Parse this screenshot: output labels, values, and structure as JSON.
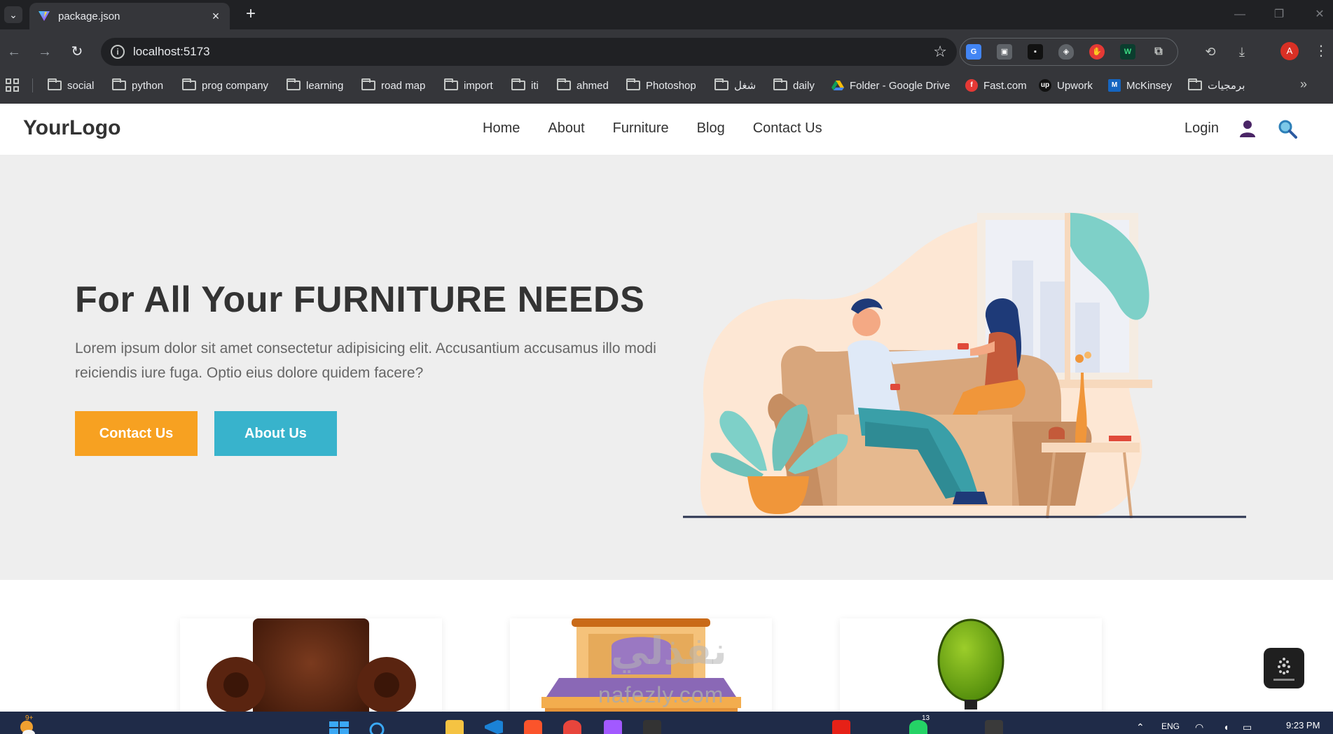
{
  "browser": {
    "tab_title": "package.json",
    "tab_close": "×",
    "new_tab": "+",
    "url": "localhost:5173",
    "profile_initial": "A",
    "window_controls": [
      "—",
      "❐",
      "✕"
    ],
    "bookmarks": [
      {
        "label": "social",
        "icon": "folder-icon"
      },
      {
        "label": "python",
        "icon": "folder-icon"
      },
      {
        "label": "prog company",
        "icon": "folder-icon"
      },
      {
        "label": "learning",
        "icon": "folder-icon"
      },
      {
        "label": "road map",
        "icon": "folder-icon"
      },
      {
        "label": "import",
        "icon": "folder-icon"
      },
      {
        "label": "iti",
        "icon": "folder-icon"
      },
      {
        "label": "ahmed",
        "icon": "folder-icon"
      },
      {
        "label": "Photoshop",
        "icon": "folder-icon"
      },
      {
        "label": "شغل",
        "icon": "folder-icon"
      },
      {
        "label": "daily",
        "icon": "folder-icon"
      },
      {
        "label": "Folder - Google Drive",
        "icon": "google-drive-icon"
      },
      {
        "label": "Fast.com",
        "icon": "fast-icon"
      },
      {
        "label": "Upwork",
        "icon": "upwork-icon"
      },
      {
        "label": "McKinsey",
        "icon": "mckinsey-icon"
      },
      {
        "label": "برمجيات",
        "icon": "folder-icon"
      }
    ],
    "more_bookmarks": "»"
  },
  "site": {
    "logo": "YourLogo",
    "nav": [
      "Home",
      "About",
      "Furniture",
      "Blog",
      "Contact Us"
    ],
    "login": "Login"
  },
  "hero": {
    "title": "For All Your FURNITURE NEEDS",
    "text": "Lorem ipsum dolor sit amet consectetur adipisicing elit. Accusantium accusamus illo modi reiciendis iure fuga. Optio eius dolore quidem facere?",
    "btn_contact": "Contact Us",
    "btn_about": "About Us"
  },
  "products": [
    {
      "name": "brown-armchair"
    },
    {
      "name": "purple-bed"
    },
    {
      "name": "green-office-chair"
    }
  ],
  "watermark": {
    "arabic": "نفذلي",
    "latin": "nafezly.com"
  },
  "taskbar": {
    "language": "ENG",
    "time": "9:23 PM",
    "weather_badge": "9+",
    "whatsapp_badge": "13"
  },
  "colors": {
    "accent_orange": "#f7a121",
    "accent_blue": "#38b3cc",
    "hero_bg": "#eeeeee",
    "chrome_dark": "#202124"
  }
}
